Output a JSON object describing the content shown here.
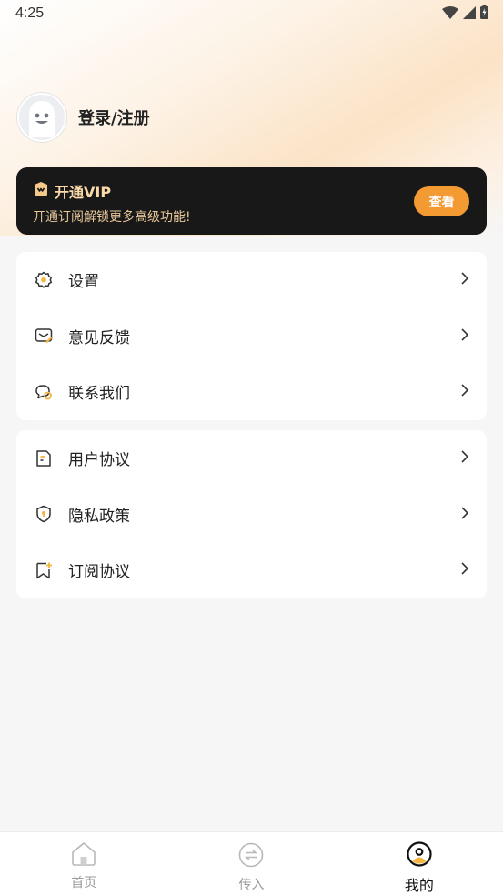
{
  "status_bar": {
    "time": "4:25"
  },
  "profile": {
    "login_label": "登录/注册"
  },
  "vip": {
    "title": "开通VIP",
    "subtitle": "开通订阅解锁更多高级功能!",
    "button": "查看"
  },
  "menu_group_1": [
    {
      "label": "设置",
      "icon": "gear-icon"
    },
    {
      "label": "意见反馈",
      "icon": "feedback-icon"
    },
    {
      "label": "联系我们",
      "icon": "chat-icon"
    }
  ],
  "menu_group_2": [
    {
      "label": "用户协议",
      "icon": "document-icon"
    },
    {
      "label": "隐私政策",
      "icon": "shield-icon"
    },
    {
      "label": "订阅协议",
      "icon": "bookmark-icon"
    }
  ],
  "tabbar": {
    "tabs": [
      {
        "label": "首页",
        "icon": "home-icon",
        "active": false
      },
      {
        "label": "传入",
        "icon": "transfer-icon",
        "active": false
      },
      {
        "label": "我的",
        "icon": "profile-icon",
        "active": true
      }
    ]
  },
  "colors": {
    "accent": "#f49a33",
    "vip_bg": "#181818",
    "vip_text": "#fbd9a8"
  }
}
